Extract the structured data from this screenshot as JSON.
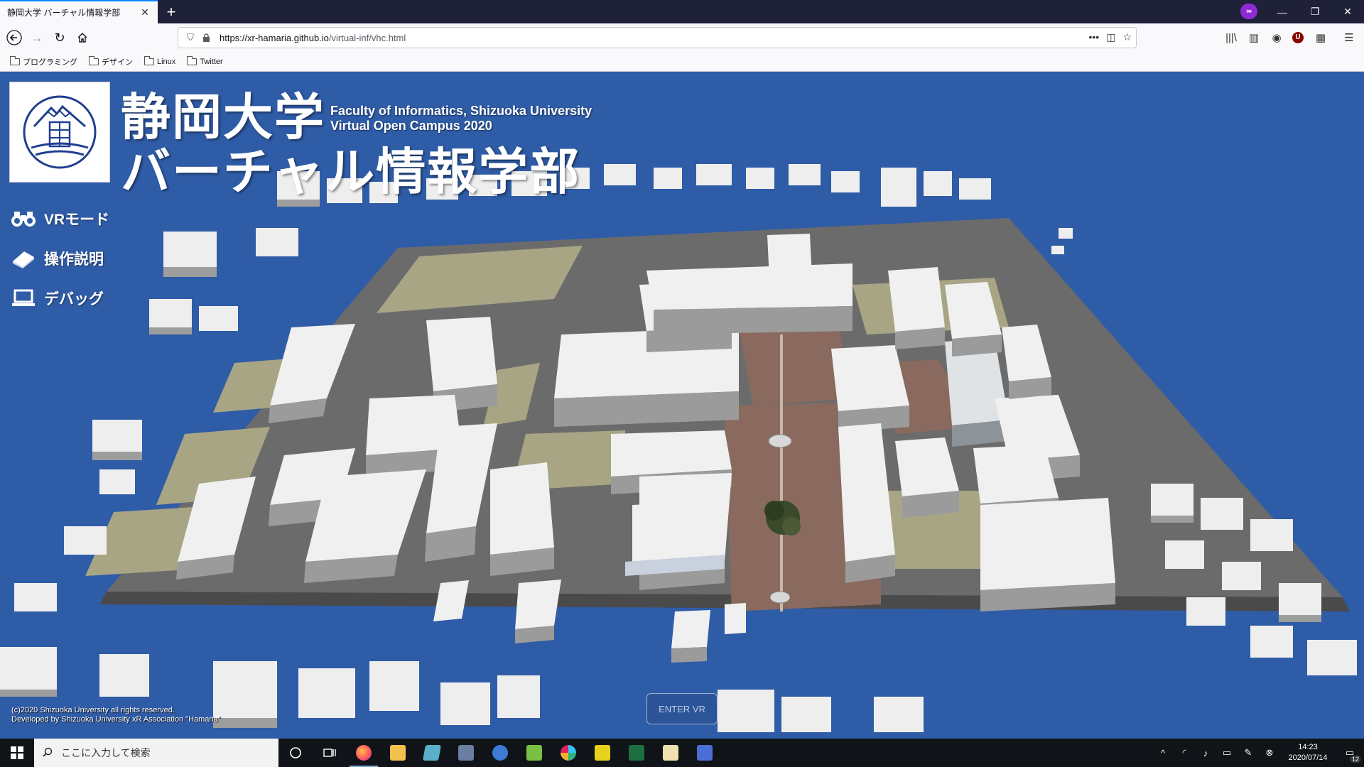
{
  "browser": {
    "tab_title": "静岡大学 バーチャル情報学部",
    "tab_close": "✕",
    "new_tab": "+",
    "url_host": "https://xr-hamaria.github.io",
    "url_path": "/virtual-inf/vhc.html",
    "page_actions_icon": "•••",
    "bookmarks": [
      "プログラミング",
      "デザイン",
      "Linux",
      "Twitter"
    ]
  },
  "page": {
    "title_jp_line1": "静岡大学",
    "title_jp_line2": "バーチャル情報学部",
    "title_en_line1": "Faculty of Informatics, Shizuoka University",
    "title_en_line2": "Virtual Open Campus 2020",
    "menu": [
      {
        "label": "VRモード",
        "icon": "binoculars-icon"
      },
      {
        "label": "操作説明",
        "icon": "book-icon"
      },
      {
        "label": "デバッグ",
        "icon": "laptop-icon"
      }
    ],
    "enter_vr": "ENTER VR",
    "copyright_line1": "(c)2020 Shizuoka University all rights reserved.",
    "copyright_line2": "Developed by Shizuoka University xR Association \"Hamaria\""
  },
  "taskbar": {
    "search_placeholder": "ここに入力して検索",
    "time": "14:23",
    "date": "2020/07/14",
    "notification_count": "12"
  },
  "colors": {
    "sky": "#2f5ca7",
    "ground": "#6b6b6b",
    "grass": "#a8a585",
    "brick": "#8a6a5e",
    "building_top": "#f2f2f2",
    "building_side": "#9a9a9a"
  }
}
